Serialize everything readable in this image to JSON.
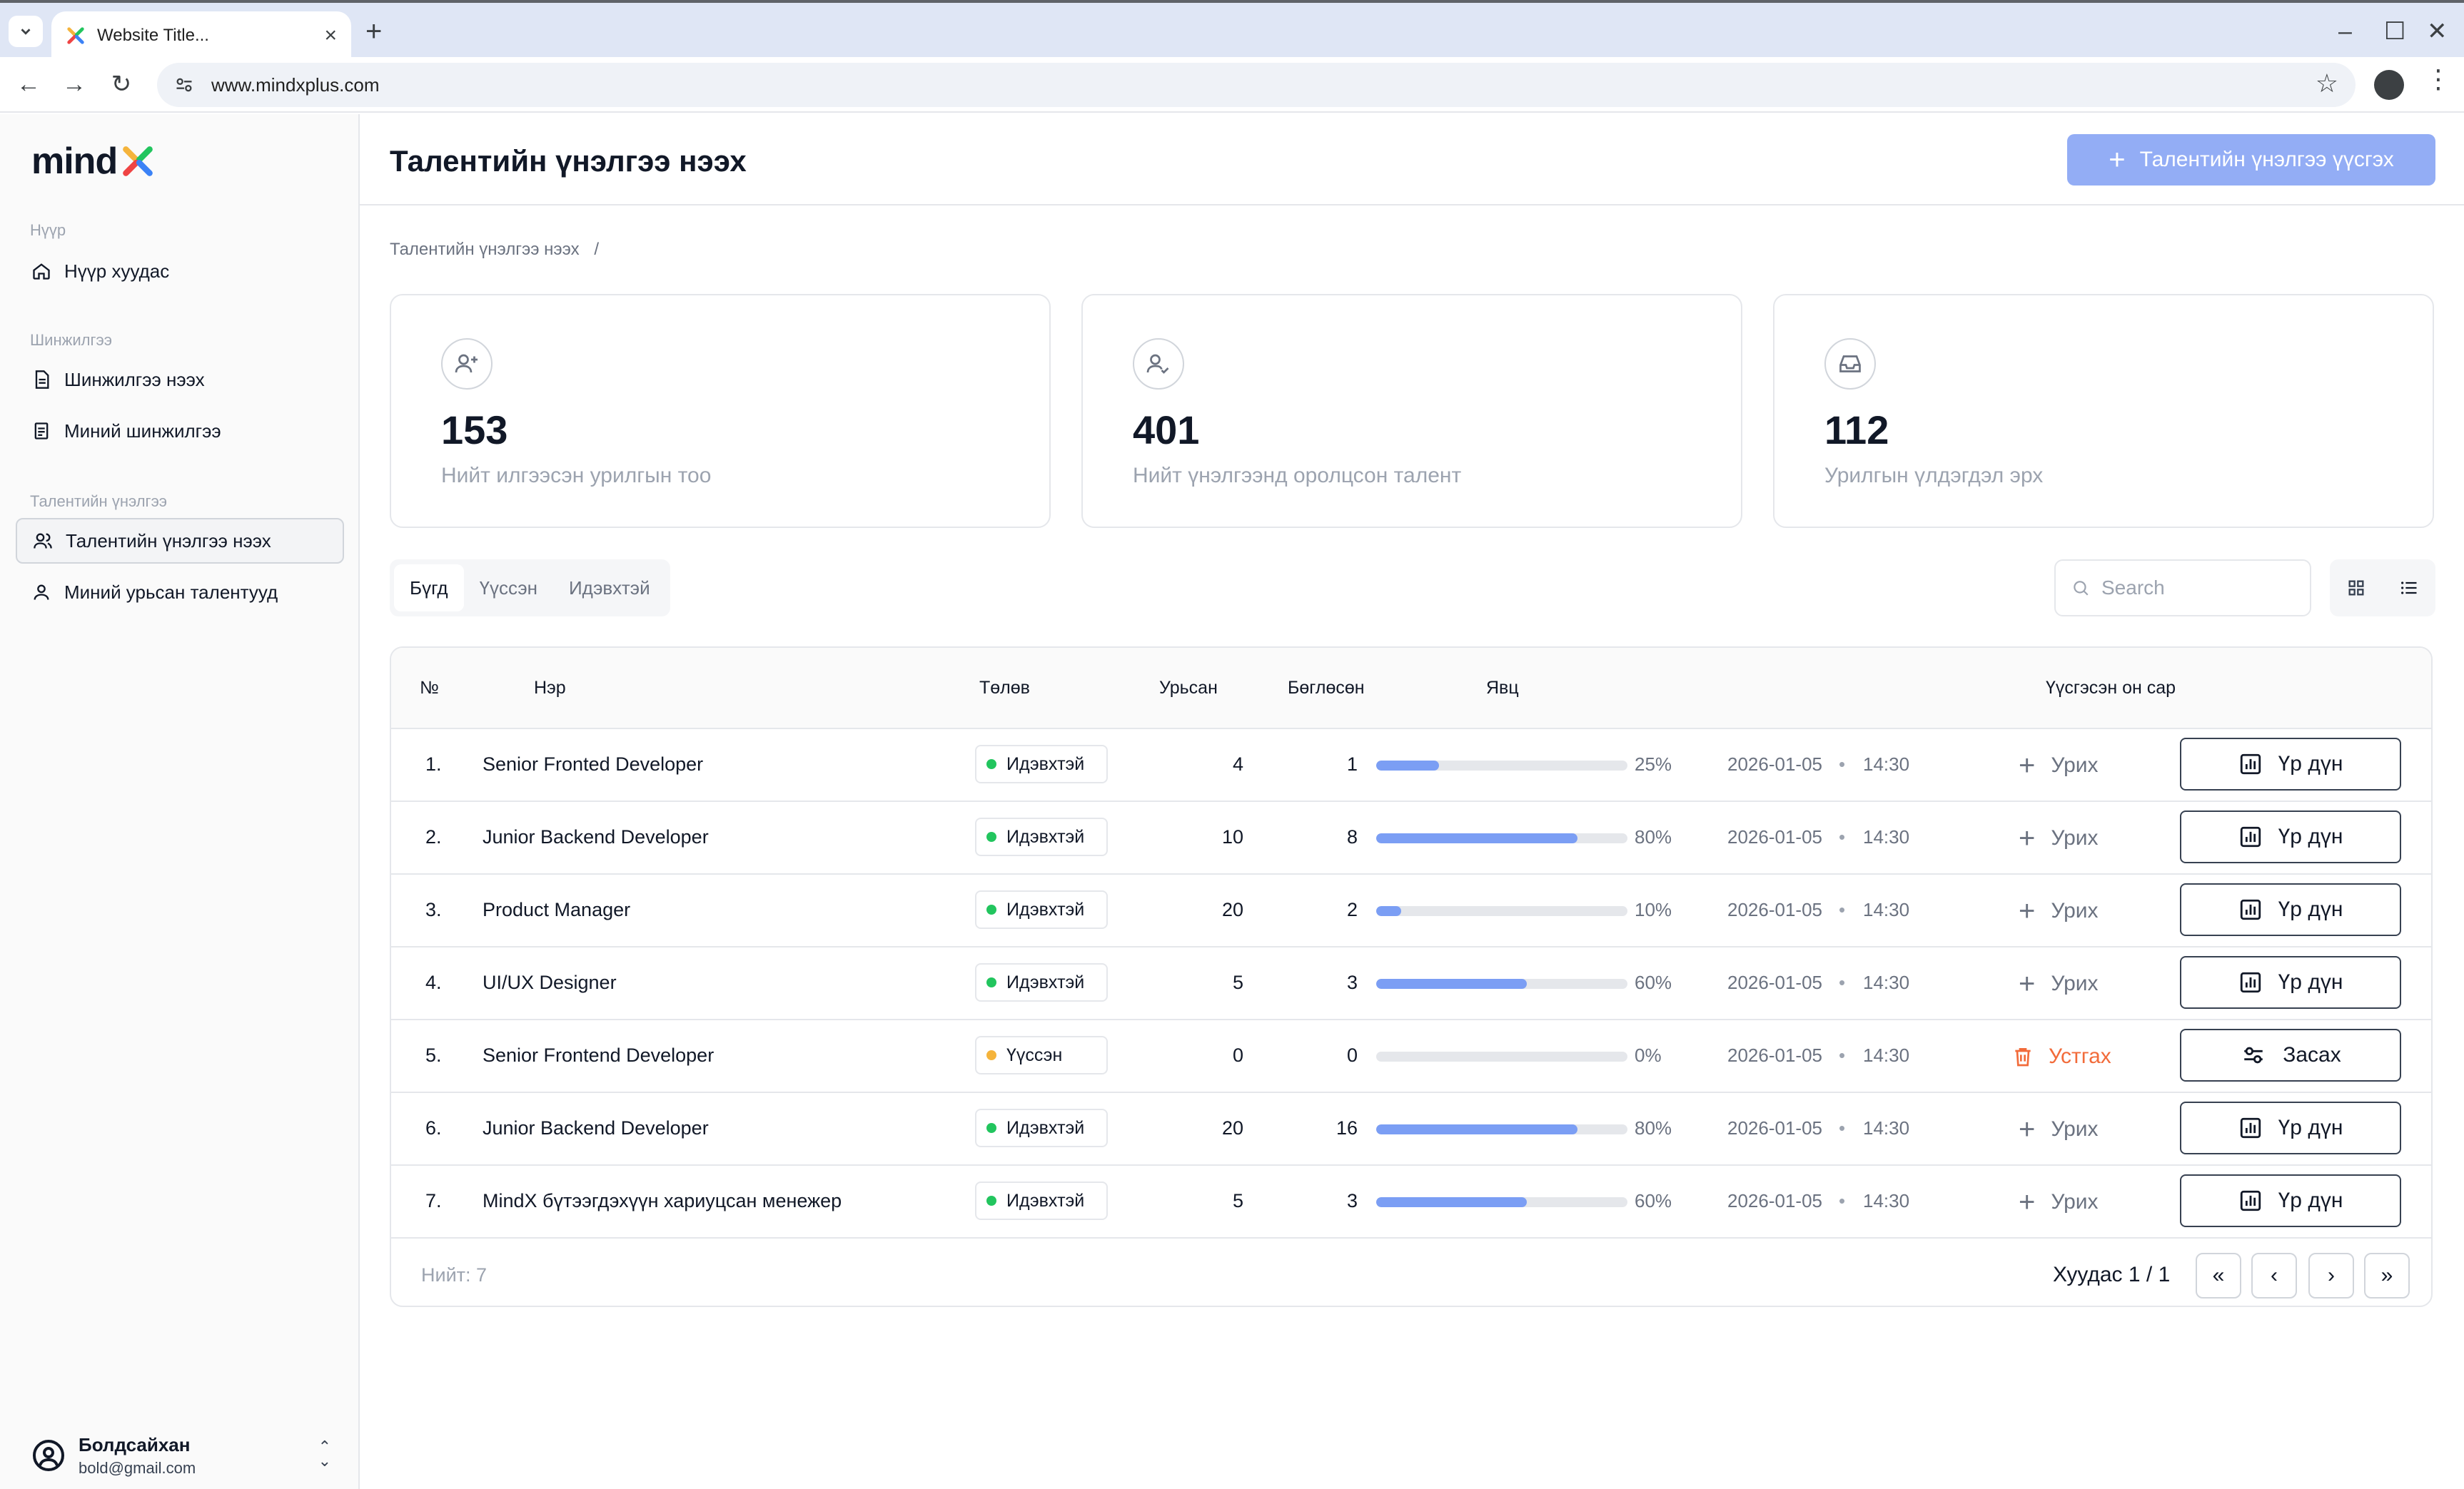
{
  "browser": {
    "tab_title": "Website Title...",
    "url": "www.mindxplus.com"
  },
  "sidebar": {
    "logo_text": "mind",
    "sections": [
      {
        "label": "Нүүр",
        "items": [
          {
            "label": "Нүүр хуудас"
          }
        ]
      },
      {
        "label": "Шинжилгээ",
        "items": [
          {
            "label": "Шинжилгээ нээх"
          },
          {
            "label": "Миний шинжилгээ"
          }
        ]
      },
      {
        "label": "Талентийн үнэлгээ",
        "items": [
          {
            "label": "Талентийн үнэлгээ нээх"
          },
          {
            "label": "Миний урьсан талентууд"
          }
        ]
      }
    ],
    "user": {
      "name": "Болдсайхан",
      "email": "bold@gmail.com"
    }
  },
  "header": {
    "title": "Талентийн үнэлгээ нээх",
    "create_label": "Талентийн үнэлгээ үүсгэх"
  },
  "breadcrumb": {
    "item": "Талентийн үнэлгээ нээх",
    "separator": "/"
  },
  "stats": [
    {
      "value": "153",
      "label": "Нийт илгээсэн урилгын тоо",
      "icon": "user-plus-icon"
    },
    {
      "value": "401",
      "label": "Нийт үнэлгээнд оролцсон талент",
      "icon": "user-check-icon"
    },
    {
      "value": "112",
      "label": "Урилгын үлдэгдэл эрх",
      "icon": "inbox-icon"
    }
  ],
  "filters": {
    "tabs": [
      {
        "label": "Бүгд"
      },
      {
        "label": "Үүссэн"
      },
      {
        "label": "Идэвхтэй"
      }
    ],
    "active": "Бүгд"
  },
  "search": {
    "placeholder": "Search"
  },
  "table": {
    "columns": {
      "no": "№",
      "name": "Нэр",
      "status": "Төлөв",
      "invited": "Урьсан",
      "completed": "Бөглөсөн",
      "progress": "Явц",
      "created": "Үүсгэсэн он сар"
    },
    "rows": [
      {
        "no": "1.",
        "name": "Senior Fronted Developer",
        "status": "Идэвхтэй",
        "invited": "4",
        "completed": "1",
        "progress": 25,
        "progress_label": "25%",
        "date": "2026-01-05",
        "time": "14:30",
        "action": "Урих",
        "button": "Үр дүн"
      },
      {
        "no": "2.",
        "name": "Junior Backend Developer",
        "status": "Идэвхтэй",
        "invited": "10",
        "completed": "8",
        "progress": 80,
        "progress_label": "80%",
        "date": "2026-01-05",
        "time": "14:30",
        "action": "Урих",
        "button": "Үр дүн"
      },
      {
        "no": "3.",
        "name": "Product Manager",
        "status": "Идэвхтэй",
        "invited": "20",
        "completed": "2",
        "progress": 10,
        "progress_label": "10%",
        "date": "2026-01-05",
        "time": "14:30",
        "action": "Урих",
        "button": "Үр дүн"
      },
      {
        "no": "4.",
        "name": "UI/UX Designer",
        "status": "Идэвхтэй",
        "invited": "5",
        "completed": "3",
        "progress": 60,
        "progress_label": "60%",
        "date": "2026-01-05",
        "time": "14:30",
        "action": "Урих",
        "button": "Үр дүн"
      },
      {
        "no": "5.",
        "name": "Senior Frontend Developer",
        "status": "Үүссэн",
        "invited": "0",
        "completed": "0",
        "progress": 0,
        "progress_label": "0%",
        "date": "2026-01-05",
        "time": "14:30",
        "action": "Устгах",
        "button": "Засах"
      },
      {
        "no": "6.",
        "name": "Junior Backend Developer",
        "status": "Идэвхтэй",
        "invited": "20",
        "completed": "16",
        "progress": 80,
        "progress_label": "80%",
        "date": "2026-01-05",
        "time": "14:30",
        "action": "Урих",
        "button": "Үр дүн"
      },
      {
        "no": "7.",
        "name": "MindX  бүтээгдэхүүн хариуцсан  менежер",
        "status": "Идэвхтэй",
        "invited": "5",
        "completed": "3",
        "progress": 60,
        "progress_label": "60%",
        "date": "2026-01-05",
        "time": "14:30",
        "action": "Урих",
        "button": "Үр дүн"
      }
    ],
    "footer": {
      "total": "Нийт: 7",
      "page": "Хуудас 1 / 1"
    }
  },
  "colors": {
    "accent": "#93adf5",
    "progress": "#7b9ef4",
    "active_dot": "#22c55e",
    "created_dot": "#f5b43c",
    "danger": "#f26b3a"
  }
}
